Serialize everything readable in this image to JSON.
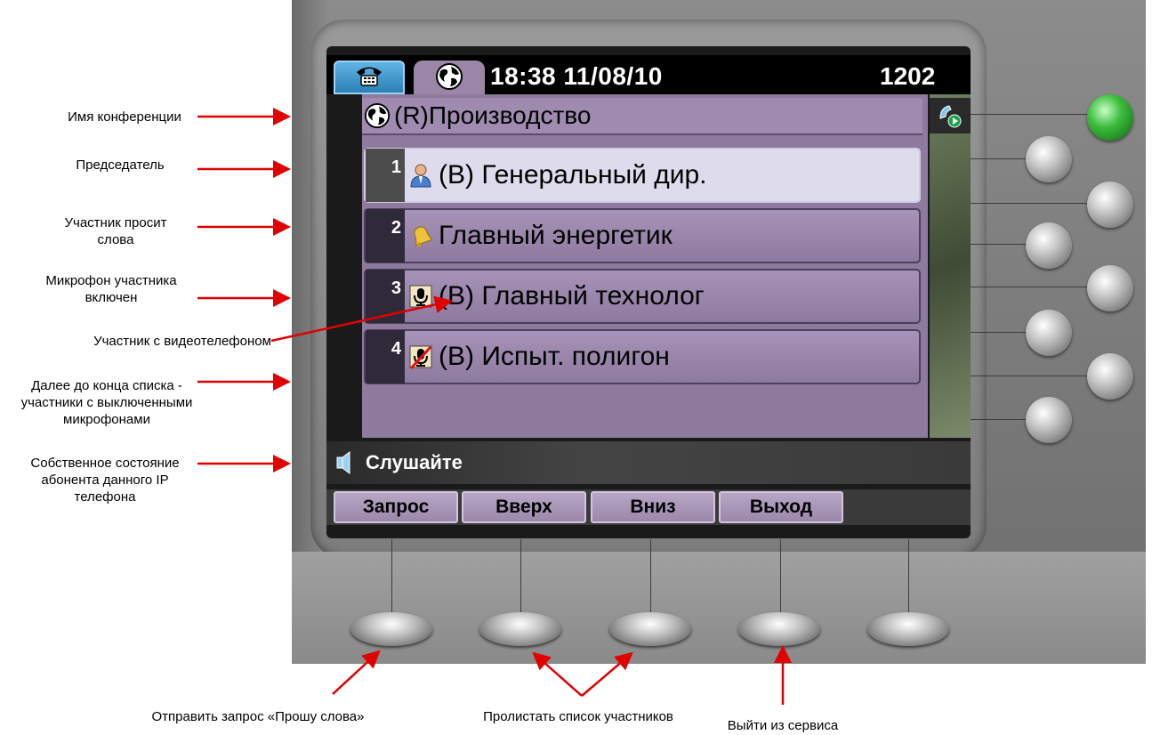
{
  "screen": {
    "time_date": "18:38 11/08/10",
    "extension": "1202",
    "conference_name": "(R)Производство",
    "participants": [
      {
        "num": "1",
        "name": "(B) Генеральный дир.",
        "icon": "chairman-icon",
        "selected": true
      },
      {
        "num": "2",
        "name": "Главный энергетик",
        "icon": "bell-icon",
        "selected": false
      },
      {
        "num": "3",
        "name": "(B) Главный технолог",
        "icon": "microphone-on-icon",
        "selected": false
      },
      {
        "num": "4",
        "name": "(B) Испыт. полигон",
        "icon": "microphone-muted-icon",
        "selected": false
      }
    ],
    "state_text": "Слушайте",
    "softkeys": [
      "Запрос",
      "Вверх",
      "Вниз",
      "Выход"
    ]
  },
  "annotations": {
    "conf_name": "Имя конференции",
    "chairman": "Председатель",
    "requests_floor_1": "Участник просит",
    "requests_floor_2": "слова",
    "mic_on_1": "Микрофон участника",
    "mic_on_2": "включен",
    "video_phone": "Участник с видеотелефоном",
    "muted_1": "Далее до конца списка -",
    "muted_2": "участники с выключенными",
    "muted_3": "микрофонами",
    "own_state_1": "Собственное состояние",
    "own_state_2": "абонента данного IP",
    "own_state_3": "телефона",
    "send_request": "Отправить запрос «Прошу слова»",
    "scroll_list": "Пролистать список участников",
    "exit_service": "Выйти из сервиса"
  },
  "colors": {
    "arrow": "#e00000",
    "selected_row": "#dedcec",
    "row": "#9a86ab",
    "line_key_active": "#3dbd3d"
  }
}
